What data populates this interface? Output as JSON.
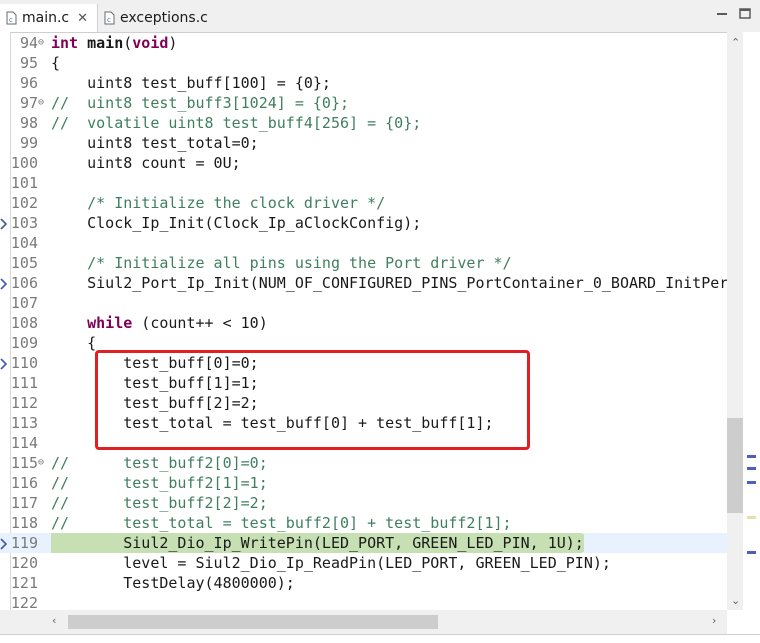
{
  "tabs": [
    {
      "label": "main.c",
      "active": true,
      "close": "✕"
    },
    {
      "label": "exceptions.c",
      "active": false
    }
  ],
  "colors": {
    "keyword": "#7f0055",
    "comment": "#3f7f5f",
    "debug_line": "#c6e0b4",
    "highlight_box": "#e02020"
  },
  "lines": [
    {
      "num": "94",
      "fold": "⊖",
      "segs": [
        {
          "t": "int",
          "c": "kw"
        },
        {
          "t": " "
        },
        {
          "t": "main",
          "c": "bold"
        },
        {
          "t": "("
        },
        {
          "t": "void",
          "c": "kw"
        },
        {
          "t": ")"
        }
      ]
    },
    {
      "num": "95",
      "segs": [
        {
          "t": "{"
        }
      ]
    },
    {
      "num": "96",
      "segs": [
        {
          "t": "    uint8 test_buff[100] = {0};"
        }
      ]
    },
    {
      "num": "97",
      "fold": "⊖",
      "segs": [
        {
          "t": "//  uint8 test_buff3[1024] = {0};",
          "c": "cmt"
        }
      ]
    },
    {
      "num": "98",
      "segs": [
        {
          "t": "//  volatile uint8 test_buff4[256] = {0};",
          "c": "cmt"
        }
      ]
    },
    {
      "num": "99",
      "segs": [
        {
          "t": "    uint8 test_total=0;"
        }
      ]
    },
    {
      "num": "100",
      "segs": [
        {
          "t": "    uint8 count = 0U;"
        }
      ]
    },
    {
      "num": "101",
      "segs": [
        {
          "t": ""
        }
      ]
    },
    {
      "num": "102",
      "segs": [
        {
          "t": "    "
        },
        {
          "t": "/* Initialize the clock driver */",
          "c": "cmt"
        }
      ]
    },
    {
      "num": "103",
      "bp": true,
      "segs": [
        {
          "t": "    Clock_Ip_Init(Clock_Ip_aClockConfig);"
        }
      ]
    },
    {
      "num": "104",
      "segs": [
        {
          "t": ""
        }
      ]
    },
    {
      "num": "105",
      "segs": [
        {
          "t": "    "
        },
        {
          "t": "/* Initialize all pins using the Port driver */",
          "c": "cmt"
        }
      ]
    },
    {
      "num": "106",
      "bp": true,
      "segs": [
        {
          "t": "    Siul2_Port_Ip_Init(NUM_OF_CONFIGURED_PINS_PortContainer_0_BOARD_InitPer"
        }
      ]
    },
    {
      "num": "107",
      "segs": [
        {
          "t": ""
        }
      ]
    },
    {
      "num": "108",
      "segs": [
        {
          "t": "    "
        },
        {
          "t": "while",
          "c": "kw"
        },
        {
          "t": " (count++ < 10)"
        }
      ]
    },
    {
      "num": "109",
      "segs": [
        {
          "t": "    {"
        }
      ]
    },
    {
      "num": "110",
      "bp": true,
      "segs": [
        {
          "t": "        test_buff[0]=0;"
        }
      ]
    },
    {
      "num": "111",
      "segs": [
        {
          "t": "        test_buff[1]=1;"
        }
      ]
    },
    {
      "num": "112",
      "segs": [
        {
          "t": "        test_buff[2]=2;"
        }
      ]
    },
    {
      "num": "113",
      "segs": [
        {
          "t": "        test_total = test_buff[0] + test_buff[1];"
        }
      ]
    },
    {
      "num": "114",
      "segs": [
        {
          "t": ""
        }
      ]
    },
    {
      "num": "115",
      "fold": "⊖",
      "segs": [
        {
          "t": "//      test_buff2[0]=0;",
          "c": "cmt"
        }
      ]
    },
    {
      "num": "116",
      "segs": [
        {
          "t": "//      test_buff2[1]=1;",
          "c": "cmt"
        }
      ]
    },
    {
      "num": "117",
      "segs": [
        {
          "t": "//      test_buff2[2]=2;",
          "c": "cmt"
        }
      ]
    },
    {
      "num": "118",
      "segs": [
        {
          "t": "//      test_total = test_buff2[0] + test_buff2[1];",
          "c": "cmt"
        }
      ]
    },
    {
      "num": "119",
      "current": true,
      "bp": true,
      "segs": [
        {
          "t": "        "
        },
        {
          "t": "Siul2_Dio_Ip_WritePin(LED_PORT, GREEN_LED_PIN, 1U);",
          "c": "dbg"
        }
      ]
    },
    {
      "num": "120",
      "segs": [
        {
          "t": "        level = Siul2_Dio_Ip_ReadPin(LED_PORT, GREEN_LED_PIN);"
        }
      ]
    },
    {
      "num": "121",
      "segs": [
        {
          "t": "        TestDelay(4800000);"
        }
      ]
    },
    {
      "num": "122",
      "segs": [
        {
          "t": ""
        }
      ]
    }
  ]
}
